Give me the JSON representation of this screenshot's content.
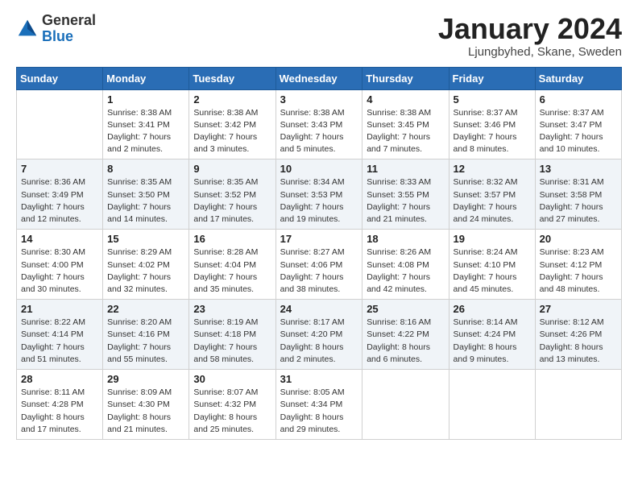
{
  "header": {
    "logo_general": "General",
    "logo_blue": "Blue",
    "month_title": "January 2024",
    "location": "Ljungbyhed, Skane, Sweden"
  },
  "weekdays": [
    "Sunday",
    "Monday",
    "Tuesday",
    "Wednesday",
    "Thursday",
    "Friday",
    "Saturday"
  ],
  "weeks": [
    [
      {
        "day": "",
        "sunrise": "",
        "sunset": "",
        "daylight": ""
      },
      {
        "day": "1",
        "sunrise": "Sunrise: 8:38 AM",
        "sunset": "Sunset: 3:41 PM",
        "daylight": "Daylight: 7 hours and 2 minutes."
      },
      {
        "day": "2",
        "sunrise": "Sunrise: 8:38 AM",
        "sunset": "Sunset: 3:42 PM",
        "daylight": "Daylight: 7 hours and 3 minutes."
      },
      {
        "day": "3",
        "sunrise": "Sunrise: 8:38 AM",
        "sunset": "Sunset: 3:43 PM",
        "daylight": "Daylight: 7 hours and 5 minutes."
      },
      {
        "day": "4",
        "sunrise": "Sunrise: 8:38 AM",
        "sunset": "Sunset: 3:45 PM",
        "daylight": "Daylight: 7 hours and 7 minutes."
      },
      {
        "day": "5",
        "sunrise": "Sunrise: 8:37 AM",
        "sunset": "Sunset: 3:46 PM",
        "daylight": "Daylight: 7 hours and 8 minutes."
      },
      {
        "day": "6",
        "sunrise": "Sunrise: 8:37 AM",
        "sunset": "Sunset: 3:47 PM",
        "daylight": "Daylight: 7 hours and 10 minutes."
      }
    ],
    [
      {
        "day": "7",
        "sunrise": "Sunrise: 8:36 AM",
        "sunset": "Sunset: 3:49 PM",
        "daylight": "Daylight: 7 hours and 12 minutes."
      },
      {
        "day": "8",
        "sunrise": "Sunrise: 8:35 AM",
        "sunset": "Sunset: 3:50 PM",
        "daylight": "Daylight: 7 hours and 14 minutes."
      },
      {
        "day": "9",
        "sunrise": "Sunrise: 8:35 AM",
        "sunset": "Sunset: 3:52 PM",
        "daylight": "Daylight: 7 hours and 17 minutes."
      },
      {
        "day": "10",
        "sunrise": "Sunrise: 8:34 AM",
        "sunset": "Sunset: 3:53 PM",
        "daylight": "Daylight: 7 hours and 19 minutes."
      },
      {
        "day": "11",
        "sunrise": "Sunrise: 8:33 AM",
        "sunset": "Sunset: 3:55 PM",
        "daylight": "Daylight: 7 hours and 21 minutes."
      },
      {
        "day": "12",
        "sunrise": "Sunrise: 8:32 AM",
        "sunset": "Sunset: 3:57 PM",
        "daylight": "Daylight: 7 hours and 24 minutes."
      },
      {
        "day": "13",
        "sunrise": "Sunrise: 8:31 AM",
        "sunset": "Sunset: 3:58 PM",
        "daylight": "Daylight: 7 hours and 27 minutes."
      }
    ],
    [
      {
        "day": "14",
        "sunrise": "Sunrise: 8:30 AM",
        "sunset": "Sunset: 4:00 PM",
        "daylight": "Daylight: 7 hours and 30 minutes."
      },
      {
        "day": "15",
        "sunrise": "Sunrise: 8:29 AM",
        "sunset": "Sunset: 4:02 PM",
        "daylight": "Daylight: 7 hours and 32 minutes."
      },
      {
        "day": "16",
        "sunrise": "Sunrise: 8:28 AM",
        "sunset": "Sunset: 4:04 PM",
        "daylight": "Daylight: 7 hours and 35 minutes."
      },
      {
        "day": "17",
        "sunrise": "Sunrise: 8:27 AM",
        "sunset": "Sunset: 4:06 PM",
        "daylight": "Daylight: 7 hours and 38 minutes."
      },
      {
        "day": "18",
        "sunrise": "Sunrise: 8:26 AM",
        "sunset": "Sunset: 4:08 PM",
        "daylight": "Daylight: 7 hours and 42 minutes."
      },
      {
        "day": "19",
        "sunrise": "Sunrise: 8:24 AM",
        "sunset": "Sunset: 4:10 PM",
        "daylight": "Daylight: 7 hours and 45 minutes."
      },
      {
        "day": "20",
        "sunrise": "Sunrise: 8:23 AM",
        "sunset": "Sunset: 4:12 PM",
        "daylight": "Daylight: 7 hours and 48 minutes."
      }
    ],
    [
      {
        "day": "21",
        "sunrise": "Sunrise: 8:22 AM",
        "sunset": "Sunset: 4:14 PM",
        "daylight": "Daylight: 7 hours and 51 minutes."
      },
      {
        "day": "22",
        "sunrise": "Sunrise: 8:20 AM",
        "sunset": "Sunset: 4:16 PM",
        "daylight": "Daylight: 7 hours and 55 minutes."
      },
      {
        "day": "23",
        "sunrise": "Sunrise: 8:19 AM",
        "sunset": "Sunset: 4:18 PM",
        "daylight": "Daylight: 7 hours and 58 minutes."
      },
      {
        "day": "24",
        "sunrise": "Sunrise: 8:17 AM",
        "sunset": "Sunset: 4:20 PM",
        "daylight": "Daylight: 8 hours and 2 minutes."
      },
      {
        "day": "25",
        "sunrise": "Sunrise: 8:16 AM",
        "sunset": "Sunset: 4:22 PM",
        "daylight": "Daylight: 8 hours and 6 minutes."
      },
      {
        "day": "26",
        "sunrise": "Sunrise: 8:14 AM",
        "sunset": "Sunset: 4:24 PM",
        "daylight": "Daylight: 8 hours and 9 minutes."
      },
      {
        "day": "27",
        "sunrise": "Sunrise: 8:12 AM",
        "sunset": "Sunset: 4:26 PM",
        "daylight": "Daylight: 8 hours and 13 minutes."
      }
    ],
    [
      {
        "day": "28",
        "sunrise": "Sunrise: 8:11 AM",
        "sunset": "Sunset: 4:28 PM",
        "daylight": "Daylight: 8 hours and 17 minutes."
      },
      {
        "day": "29",
        "sunrise": "Sunrise: 8:09 AM",
        "sunset": "Sunset: 4:30 PM",
        "daylight": "Daylight: 8 hours and 21 minutes."
      },
      {
        "day": "30",
        "sunrise": "Sunrise: 8:07 AM",
        "sunset": "Sunset: 4:32 PM",
        "daylight": "Daylight: 8 hours and 25 minutes."
      },
      {
        "day": "31",
        "sunrise": "Sunrise: 8:05 AM",
        "sunset": "Sunset: 4:34 PM",
        "daylight": "Daylight: 8 hours and 29 minutes."
      },
      {
        "day": "",
        "sunrise": "",
        "sunset": "",
        "daylight": ""
      },
      {
        "day": "",
        "sunrise": "",
        "sunset": "",
        "daylight": ""
      },
      {
        "day": "",
        "sunrise": "",
        "sunset": "",
        "daylight": ""
      }
    ]
  ]
}
